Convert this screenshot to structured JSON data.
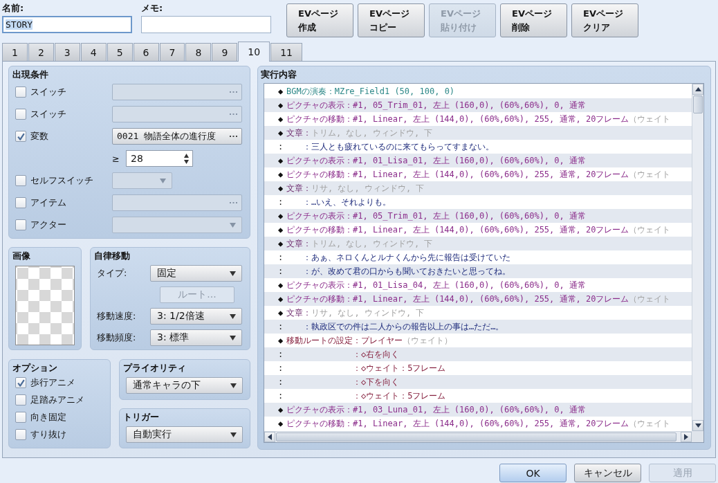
{
  "name_field": {
    "label": "名前:",
    "value": "STORY",
    "text_selected": true
  },
  "memo_field": {
    "label": "メモ:"
  },
  "page_buttons": [
    {
      "label": "EVページ作成",
      "disabled": false
    },
    {
      "label": "EVページコピー",
      "disabled": false
    },
    {
      "label": "EVページ貼り付け",
      "disabled": true
    },
    {
      "label": "EVページ削除",
      "disabled": false
    },
    {
      "label": "EVページクリア",
      "disabled": false
    }
  ],
  "tabs": [
    {
      "label": "1",
      "selected": false
    },
    {
      "label": "2",
      "selected": false
    },
    {
      "label": "3",
      "selected": false
    },
    {
      "label": "4",
      "selected": false
    },
    {
      "label": "5",
      "selected": false
    },
    {
      "label": "6",
      "selected": false
    },
    {
      "label": "7",
      "selected": false
    },
    {
      "label": "8",
      "selected": false
    },
    {
      "label": "9",
      "selected": false
    },
    {
      "label": "10",
      "selected": true
    },
    {
      "label": "11",
      "selected": false
    }
  ],
  "conditions": {
    "title": "出現条件",
    "rows": [
      {
        "kind": "picker",
        "label": "スイッチ",
        "checked": false
      },
      {
        "kind": "picker",
        "label": "スイッチ",
        "checked": false
      },
      {
        "kind": "picker",
        "label": "変数",
        "checked": true,
        "value": "0021 物語全体の進行度",
        "operator": "≥",
        "amount": "28"
      },
      {
        "kind": "short_dropdown",
        "label": "セルフスイッチ",
        "checked": false
      },
      {
        "kind": "picker",
        "label": "アイテム",
        "checked": false
      },
      {
        "kind": "dropdown",
        "label": "アクター",
        "checked": false
      }
    ]
  },
  "image": {
    "title": "画像"
  },
  "movement": {
    "title": "自律移動",
    "rows": [
      {
        "kind": "dropdown",
        "label": "タイプ:",
        "value": "固定"
      },
      {
        "kind": "button",
        "label": "ルート...",
        "disabled": true
      },
      {
        "kind": "dropdown",
        "label": "移動速度:",
        "value": "3: 1/2倍速"
      },
      {
        "kind": "dropdown",
        "label": "移動頻度:",
        "value": "3: 標準"
      }
    ]
  },
  "options": {
    "title": "オプション",
    "items": [
      {
        "label": "歩行アニメ",
        "checked": true
      },
      {
        "label": "足踏みアニメ",
        "checked": false
      },
      {
        "label": "向き固定",
        "checked": false
      },
      {
        "label": "すり抜け",
        "checked": false
      }
    ]
  },
  "priority": {
    "title": "プライオリティ",
    "value": "通常キャラの下"
  },
  "trigger": {
    "title": "トリガー",
    "value": "自動実行"
  },
  "contents": {
    "title": "実行内容",
    "commands": [
      {
        "kind": "bgm",
        "marker": "◆",
        "command": "BGMの演奏：",
        "params": "MZre_Field1 (50, 100, 0)"
      },
      {
        "kind": "picture",
        "marker": "◆",
        "command": "ピクチャの表示：",
        "params": "#1, 05_Trim_01, 左上 (160,0), (60%,60%), 0, 通常"
      },
      {
        "kind": "picture",
        "marker": "◆",
        "command": "ピクチャの移動：",
        "params": "#1, Linear, 左上 (144,0), (60%,60%), 255, 通常, 20フレーム",
        "note": "（ウェイト"
      },
      {
        "kind": "message",
        "marker": "◆",
        "command": "文章：",
        "params": "トリム, なし, ウィンドウ, 下"
      },
      {
        "kind": "message_line",
        "marker": ":",
        "text": "：三人とも疲れているのに来てもらってすまない。"
      },
      {
        "kind": "picture",
        "marker": "◆",
        "command": "ピクチャの表示：",
        "params": "#1, 01_Lisa_01, 左上 (160,0), (60%,60%), 0, 通常"
      },
      {
        "kind": "picture",
        "marker": "◆",
        "command": "ピクチャの移動：",
        "params": "#1, Linear, 左上 (144,0), (60%,60%), 255, 通常, 20フレーム",
        "note": "（ウェイト"
      },
      {
        "kind": "message",
        "marker": "◆",
        "command": "文章：",
        "params": "リサ, なし, ウィンドウ, 下"
      },
      {
        "kind": "message_line",
        "marker": ":",
        "text": "：…いえ、それよりも。"
      },
      {
        "kind": "picture",
        "marker": "◆",
        "command": "ピクチャの表示：",
        "params": "#1, 05_Trim_01, 左上 (160,0), (60%,60%), 0, 通常"
      },
      {
        "kind": "picture",
        "marker": "◆",
        "command": "ピクチャの移動：",
        "params": "#1, Linear, 左上 (144,0), (60%,60%), 255, 通常, 20フレーム",
        "note": "（ウェイト"
      },
      {
        "kind": "message",
        "marker": "◆",
        "command": "文章：",
        "params": "トリム, なし, ウィンドウ, 下"
      },
      {
        "kind": "message_line",
        "marker": ":",
        "text": "：あぁ、ネロくんとルナくんから先に報告は受けていた"
      },
      {
        "kind": "message_line",
        "marker": ":",
        "text": "：が、改めて君の口からも聞いておきたいと思ってね。"
      },
      {
        "kind": "picture",
        "marker": "◆",
        "command": "ピクチャの表示：",
        "params": "#1, 01_Lisa_04, 左上 (160,0), (60%,60%), 0, 通常"
      },
      {
        "kind": "picture",
        "marker": "◆",
        "command": "ピクチャの移動：",
        "params": "#1, Linear, 左上 (144,0), (60%,60%), 255, 通常, 20フレーム",
        "note": "（ウェイト"
      },
      {
        "kind": "message",
        "marker": "◆",
        "command": "文章：",
        "params": "リサ, なし, ウィンドウ, 下"
      },
      {
        "kind": "message_line",
        "marker": ":",
        "text": "：執政区での件は二人からの報告以上の事は…ただ…。"
      },
      {
        "kind": "route",
        "marker": "◆",
        "command": "移動ルートの設定：",
        "params": "プレイヤー",
        "note": "（ウェイト）"
      },
      {
        "kind": "route_step",
        "marker": ":",
        "text": "：◇右を向く"
      },
      {
        "kind": "route_step",
        "marker": ":",
        "text": "：◇ウェイト：5フレーム"
      },
      {
        "kind": "route_step",
        "marker": ":",
        "text": "：◇下を向く"
      },
      {
        "kind": "route_step",
        "marker": ":",
        "text": "：◇ウェイト：5フレーム"
      },
      {
        "kind": "picture",
        "marker": "◆",
        "command": "ピクチャの表示：",
        "params": "#1, 03_Luna_01, 左上 (160,0), (60%,60%), 0, 通常"
      },
      {
        "kind": "picture",
        "marker": "◆",
        "command": "ピクチャの移動：",
        "params": "#1, Linear, 左上 (144,0), (60%,60%), 255, 通常, 20フレーム",
        "note": "（ウェイト"
      }
    ]
  },
  "dialog_buttons": [
    {
      "label": "OK",
      "kind": "default",
      "disabled": false
    },
    {
      "label": "キャンセル",
      "kind": "normal",
      "disabled": false
    },
    {
      "label": "適用",
      "kind": "normal",
      "disabled": true
    }
  ]
}
